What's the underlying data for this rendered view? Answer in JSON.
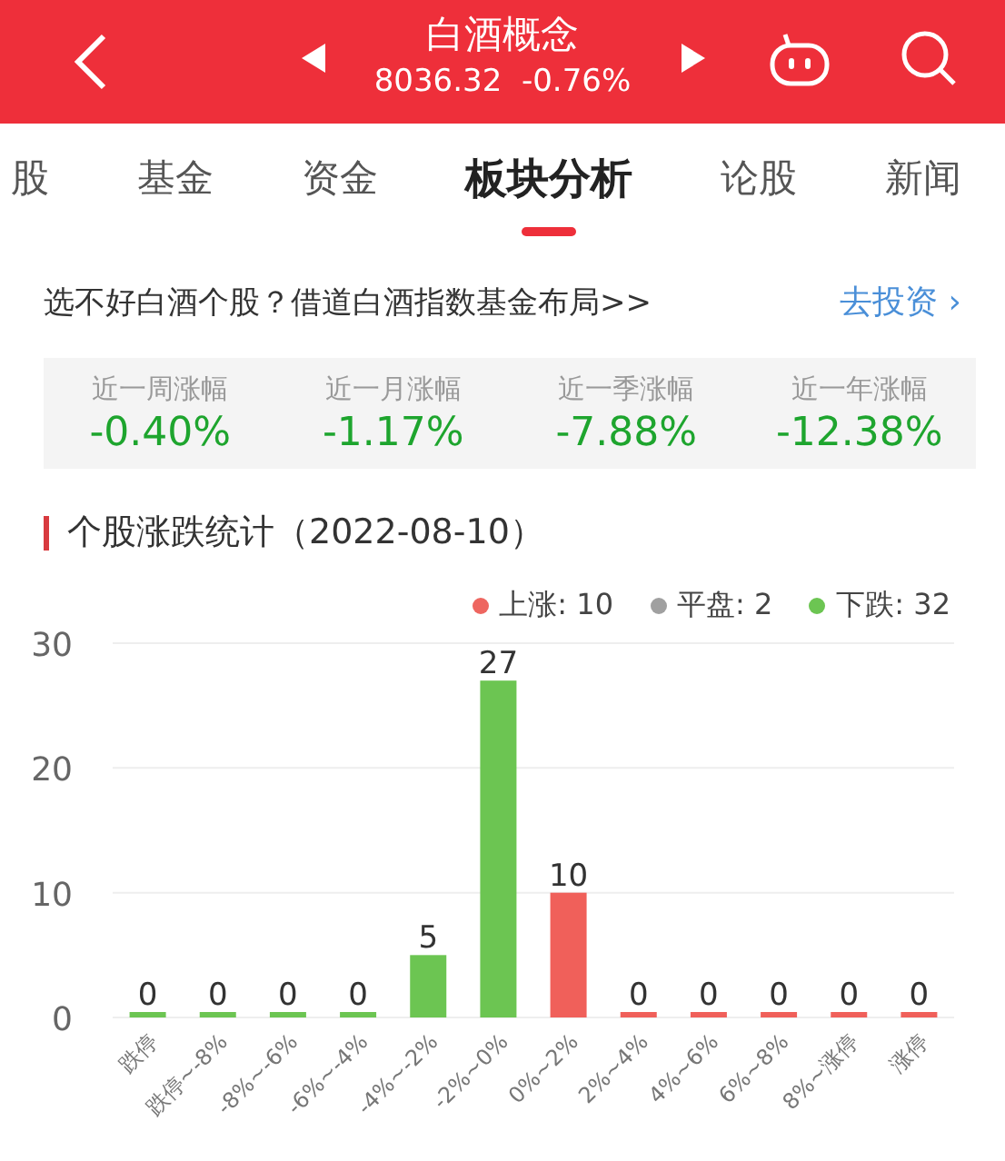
{
  "header": {
    "title": "白酒概念",
    "price": "8036.32",
    "change": "-0.76%"
  },
  "tabs": [
    {
      "label": "股",
      "selected": false
    },
    {
      "label": "基金",
      "selected": false
    },
    {
      "label": "资金",
      "selected": false
    },
    {
      "label": "板块分析",
      "selected": true
    },
    {
      "label": "论股",
      "selected": false
    },
    {
      "label": "新闻",
      "selected": false
    }
  ],
  "promo": {
    "text": "选不好白酒个股？借道白酒指数基金布局>>",
    "link": "去投资",
    "arrow": "›"
  },
  "returns": [
    {
      "label": "近一周涨幅",
      "value": "-0.40%"
    },
    {
      "label": "近一月涨幅",
      "value": "-1.17%"
    },
    {
      "label": "近一季涨幅",
      "value": "-7.88%"
    },
    {
      "label": "近一年涨幅",
      "value": "-12.38%"
    }
  ],
  "section_title": "个股涨跌统计（2022-08-10）",
  "legend": [
    {
      "label": "上涨: 10",
      "color": "#ee6660"
    },
    {
      "label": "平盘: 2",
      "color": "#a0a0a0"
    },
    {
      "label": "下跌: 32",
      "color": "#6cc552"
    }
  ],
  "chart_data": {
    "type": "bar",
    "categories": [
      "跌停",
      "跌停~-8%",
      "-8%~-6%",
      "-6%~-4%",
      "-4%~-2%",
      "-2%~0%",
      "0%~2%",
      "2%~4%",
      "4%~6%",
      "6%~8%",
      "8%~涨停",
      "涨停"
    ],
    "series": [
      {
        "color": "#6cc552",
        "values": [
          0,
          0,
          0,
          0,
          5,
          27,
          null,
          null,
          null,
          null,
          null,
          null
        ]
      },
      {
        "color": "#f0605a",
        "values": [
          null,
          null,
          null,
          null,
          null,
          null,
          10,
          0,
          0,
          0,
          0,
          0
        ]
      }
    ],
    "ylim": [
      0,
      30
    ],
    "yticks": [
      0,
      10,
      20,
      30
    ],
    "data_labels": true
  }
}
